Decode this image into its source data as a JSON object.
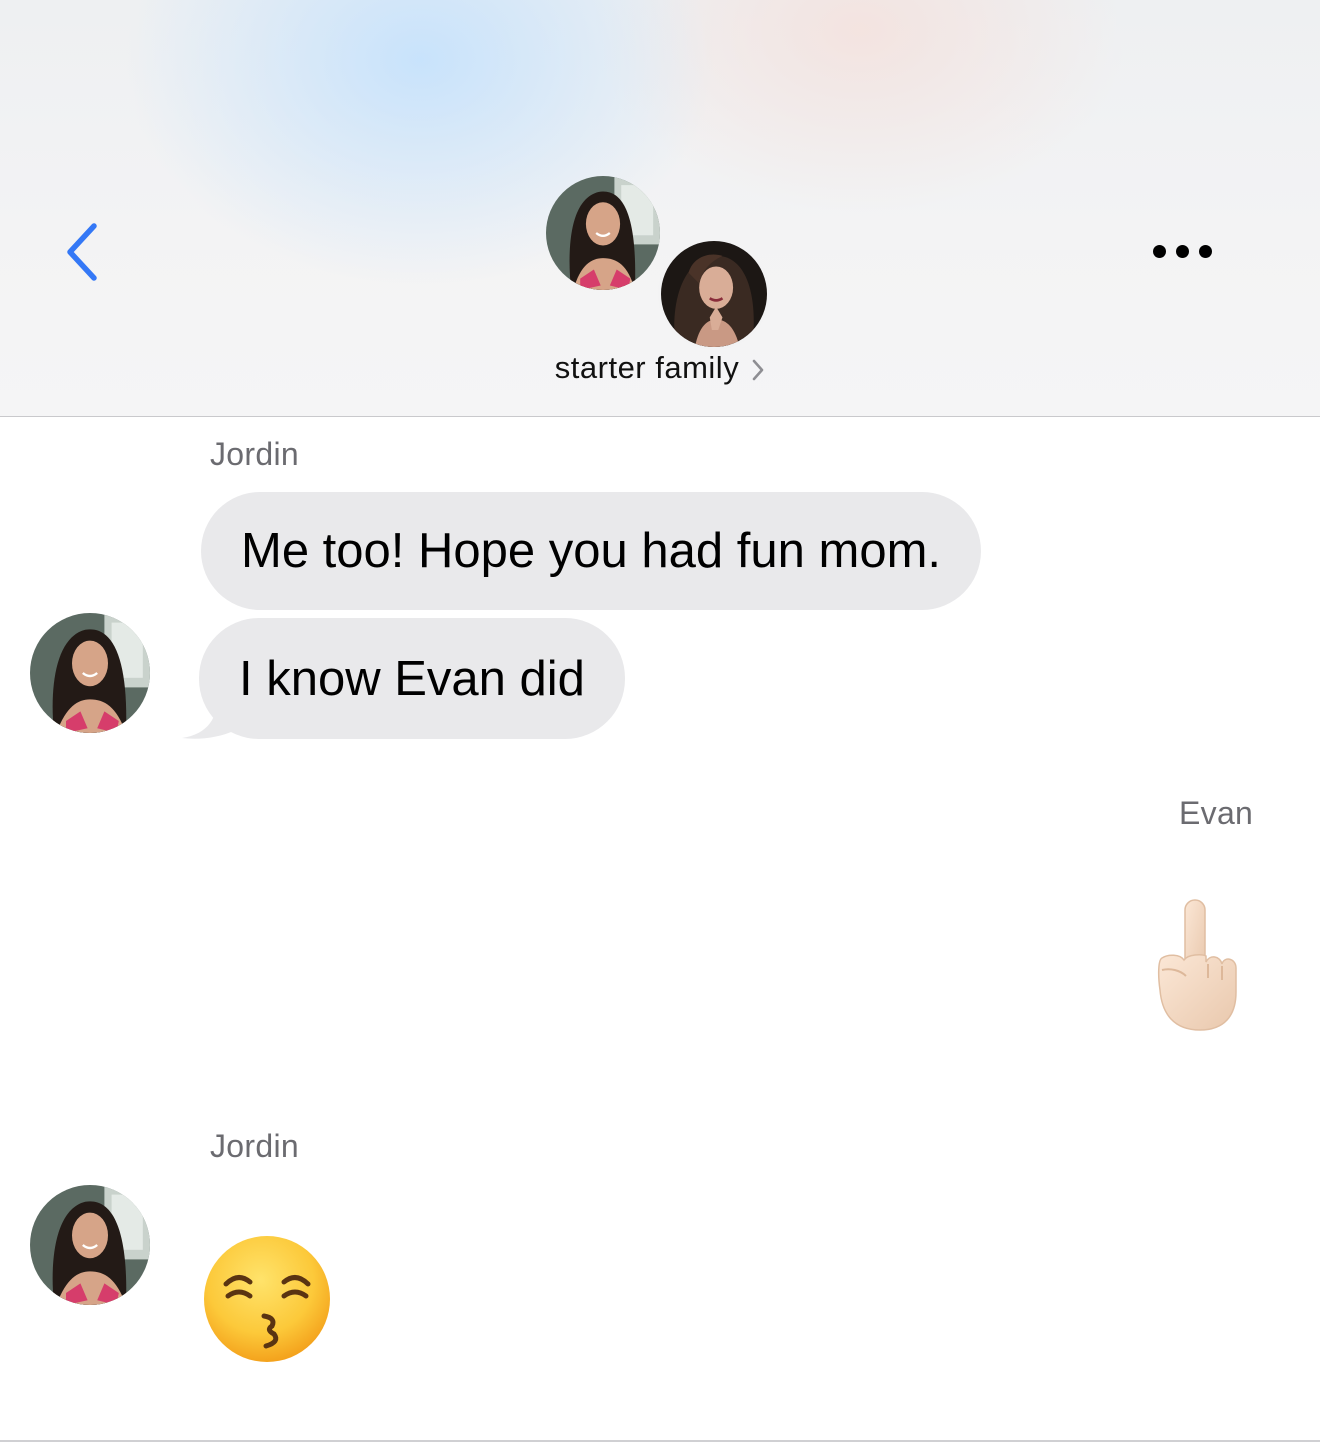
{
  "header": {
    "back_icon": "chevron-left-icon",
    "group_name": "starter family",
    "group_name_icon": "chevron-right-icon",
    "more_icon": "ellipsis-icon",
    "accent_color": "#3478f6"
  },
  "messages": [
    {
      "sender": "Jordin",
      "side": "incoming",
      "bubbles": [
        "Me too! Hope you had fun mom.",
        "I know Evan did"
      ]
    },
    {
      "sender": "Evan",
      "side": "outgoing",
      "emoji": "middle-finger-emoji"
    },
    {
      "sender": "Jordin",
      "side": "incoming",
      "emoji": "kissing-face-smiling-eyes-emoji"
    }
  ],
  "colors": {
    "incoming_bubble": "#e9e9eb",
    "sender_name": "#6b6b70"
  }
}
